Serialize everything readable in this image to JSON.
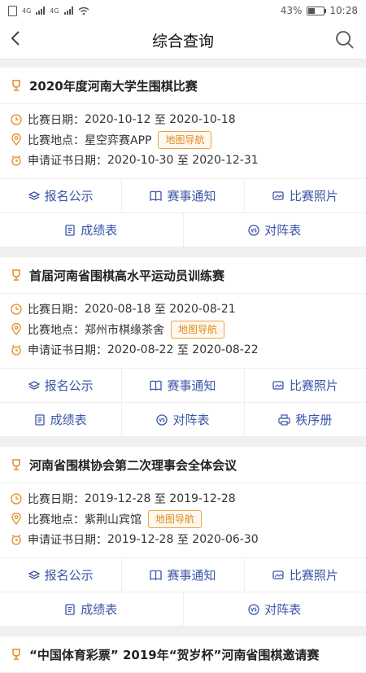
{
  "status": {
    "battery": "43%",
    "time": "10:28",
    "signal1": "4G",
    "signal2": "4G"
  },
  "nav": {
    "title": "综合查询"
  },
  "colors": {
    "accent": "#3a56a8",
    "orange": "#e08a1e"
  },
  "labels": {
    "date": "比赛日期：",
    "place": "比赛地点：",
    "cert": "申请证书日期：",
    "to": "至",
    "map": "地图导航",
    "signup": "报名公示",
    "notice": "赛事通知",
    "photos": "比赛照片",
    "scores": "成绩表",
    "pairing": "对阵表",
    "order": "秩序册"
  },
  "events": [
    {
      "title": "2020年度河南大学生围棋比赛",
      "date_from": "2020-10-12",
      "date_to": "2020-10-18",
      "place": "星空弈赛APP",
      "cert_from": "2020-10-30",
      "cert_to": "2020-12-31"
    },
    {
      "title": "首届河南省围棋高水平运动员训练赛",
      "date_from": "2020-08-18",
      "date_to": "2020-08-21",
      "place": "郑州市棋缘茶舍",
      "cert_from": "2020-08-22",
      "cert_to": "2020-08-22"
    },
    {
      "title": "河南省围棋协会第二次理事会全体会议",
      "date_from": "2019-12-28",
      "date_to": "2019-12-28",
      "place": "紫荆山宾馆",
      "cert_from": "2019-12-28",
      "cert_to": "2020-06-30"
    },
    {
      "title": "“中国体育彩票” 2019年“贺岁杯”河南省围棋邀请赛"
    }
  ]
}
